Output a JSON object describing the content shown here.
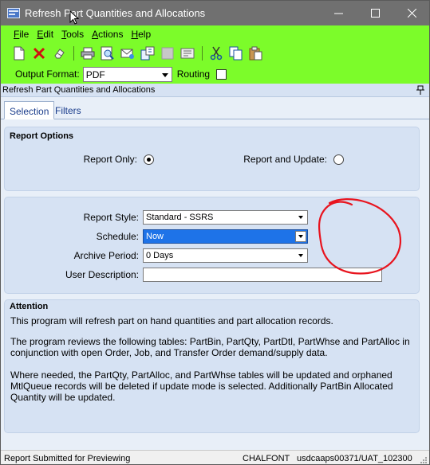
{
  "window": {
    "title": "Refresh Part Quantities and Allocations",
    "minimize_glyph": "—",
    "maximize_glyph": "☐",
    "close_glyph": "✕"
  },
  "menu": [
    {
      "label": "File",
      "accel": "F",
      "rest": "ile"
    },
    {
      "label": "Edit",
      "accel": "E",
      "rest": "dit"
    },
    {
      "label": "Tools",
      "accel": "T",
      "rest": "ools"
    },
    {
      "label": "Actions",
      "accel": "A",
      "rest": "ctions"
    },
    {
      "label": "Help",
      "accel": "H",
      "rest": "elp"
    }
  ],
  "toolbar": {
    "icons": [
      "new-icon",
      "delete-icon",
      "clear-icon",
      "print-icon",
      "print-preview-icon",
      "email-icon",
      "attach-icon",
      "disabled-icon",
      "refresh-icon",
      "cut-icon",
      "copy-icon",
      "paste-icon"
    ],
    "output_format_label": "Output Format:",
    "output_format_value": "PDF",
    "routing_label": "Routing",
    "routing_checked": false
  },
  "panel": {
    "header": "Refresh Part Quantities and Allocations"
  },
  "tabs": [
    {
      "label": "Selection",
      "active": true
    },
    {
      "label": "Filters",
      "active": false
    }
  ],
  "report_options": {
    "title": "Report Options",
    "report_only_label": "Report Only:",
    "report_only_selected": true,
    "report_update_label": "Report and Update:",
    "report_update_selected": false
  },
  "schedule_box": {
    "report_style_label": "Report Style:",
    "report_style_value": "Standard - SSRS",
    "schedule_label": "Schedule:",
    "schedule_value": "Now",
    "archive_label": "Archive Period:",
    "archive_value": "0 Days",
    "user_description_label": "User Description:",
    "user_description_value": ""
  },
  "attention": {
    "title": "Attention",
    "paragraphs": [
      "This program will refresh part on hand quantities and part allocation records.",
      "The program reviews the following tables: PartBin, PartQty, PartDtl, PartWhse and PartAlloc in conjunction with open Order, Job, and Transfer Order demand/supply data.",
      "Where needed, the PartQty, PartAlloc, and PartWhse tables will be updated and orphaned MtlQueue records will be deleted if update mode is selected. Additionally PartBin Allocated Quantity will be updated."
    ]
  },
  "status": {
    "message": "Report Submitted for Previewing",
    "user": "CHALFONT",
    "server": "usdcaaps00371/UAT_102300"
  },
  "colors": {
    "toolbar_bg": "#7cfc2a",
    "titlebar_bg": "#707070",
    "panel_bg": "#d6e2f3",
    "selected_bg": "#1e73e8",
    "annotation": "#e8141e"
  }
}
